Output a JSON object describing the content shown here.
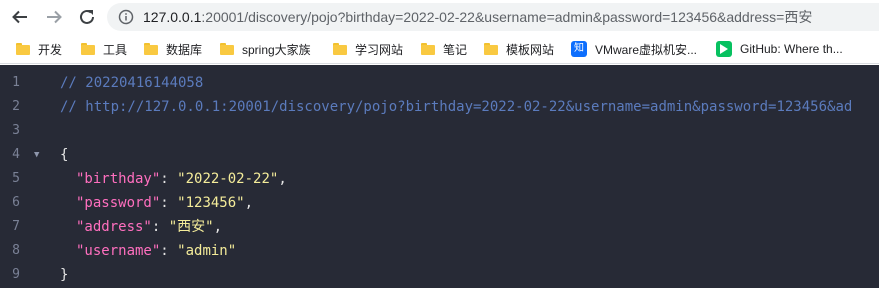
{
  "toolbar": {
    "url_host": "127.0.0.1",
    "url_path": ":20001/discovery/pojo?birthday=2022-02-22&username=admin&password=123456&address=西安"
  },
  "bookmarks": [
    {
      "label": "开发",
      "icon": "folder-icon"
    },
    {
      "label": "工具",
      "icon": "folder-icon"
    },
    {
      "label": "数据库",
      "icon": "folder-icon"
    },
    {
      "label": "spring大家族",
      "icon": "folder-icon"
    },
    {
      "label": "学习网站",
      "icon": "folder-icon"
    },
    {
      "label": "笔记",
      "icon": "folder-icon"
    },
    {
      "label": "模板网站",
      "icon": "folder-icon"
    },
    {
      "label": "VMware虚拟机安...",
      "icon": "zhihu-icon",
      "icon_text": "知"
    },
    {
      "label": "GitHub: Where th...",
      "icon": "play-icon"
    }
  ],
  "code": {
    "line_numbers": [
      "1",
      "2",
      "3",
      "4",
      "5",
      "6",
      "7",
      "8",
      "9"
    ],
    "comment1": "// 20220416144058",
    "comment2": "// http://127.0.0.1:20001/discovery/pojo?birthday=2022-02-22&username=admin&password=123456&ad",
    "open_brace": "{",
    "close_brace": "}",
    "fold_marker": "▼",
    "fields": [
      {
        "key": "\"birthday\"",
        "value": "\"2022-02-22\"",
        "comma": ","
      },
      {
        "key": "\"password\"",
        "value": "\"123456\"",
        "comma": ","
      },
      {
        "key": "\"address\"",
        "value": "\"西安\"",
        "comma": ","
      },
      {
        "key": "\"username\"",
        "value": "\"admin\"",
        "comma": ""
      }
    ]
  },
  "colors": {
    "viewer_bg": "#272a36",
    "comment": "#5b7bbd",
    "key": "#ff6fbf",
    "string": "#f4ec9a"
  }
}
